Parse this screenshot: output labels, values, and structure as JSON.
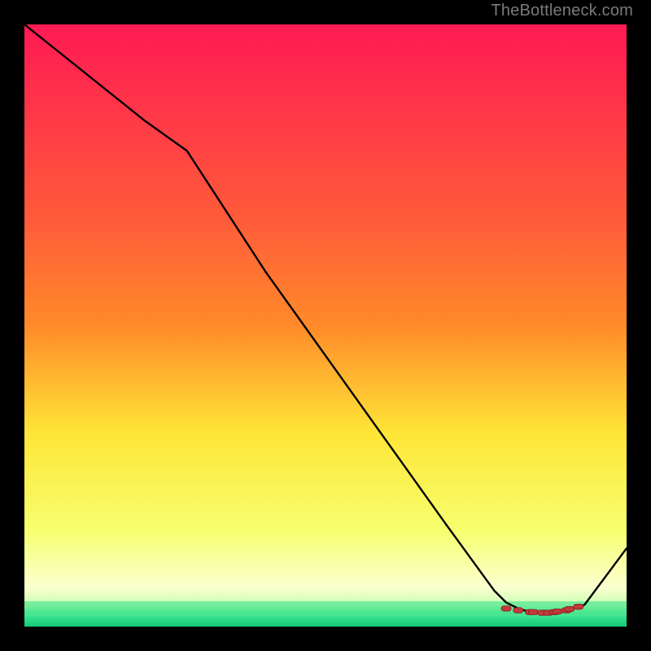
{
  "attribution": "TheBottleneck.com",
  "palette": {
    "black": "#000000",
    "line": "#000000",
    "marker": "#c23a3a",
    "grad_top": "#ff1a54",
    "grad_mid_upper": "#ff8a2a",
    "grad_mid": "#ffe637",
    "grad_lower": "#f6ff6e",
    "grad_pale": "#fbffd0",
    "grad_green": "#2fe08a"
  },
  "chart_data": {
    "type": "line",
    "title": "",
    "xlabel": "",
    "ylabel": "",
    "xlim": [
      0,
      100
    ],
    "ylim": [
      0,
      100
    ],
    "x": [
      0,
      10,
      20,
      27,
      40,
      55,
      70,
      78,
      80,
      82,
      84,
      86,
      88,
      90,
      93,
      100
    ],
    "y": [
      100,
      92,
      84,
      79,
      59,
      38,
      17,
      6,
      4,
      3,
      2.4,
      2.2,
      2.4,
      2.8,
      3.6,
      13
    ],
    "markers_x": [
      80,
      82,
      84,
      84.5,
      86,
      87,
      88,
      88.5,
      90,
      90.5,
      92
    ],
    "markers_y": [
      3.0,
      2.7,
      2.4,
      2.4,
      2.3,
      2.3,
      2.4,
      2.5,
      2.7,
      2.9,
      3.3
    ],
    "green_band_y": [
      2.0,
      4.2
    ]
  }
}
